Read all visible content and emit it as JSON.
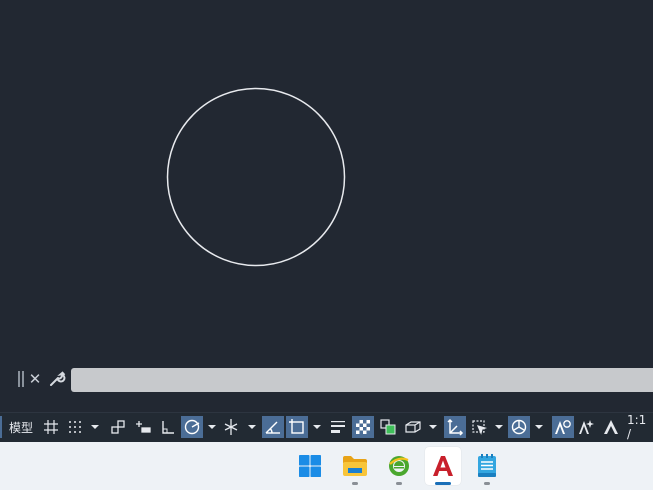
{
  "statusbar": {
    "model_label": "模型",
    "scale_label": "1:1 /"
  },
  "command_line": {
    "value": "",
    "placeholder": ""
  },
  "icons": {
    "grid": "grid-icon",
    "snap": "snap-mode-icon",
    "infer": "infer-constraints-icon",
    "dynamic_input": "dynamic-input-icon",
    "ortho": "ortho-mode-icon",
    "polar": "polar-tracking-icon",
    "isodraft": "isometric-drafting-icon",
    "object_snap_tracking": "object-snap-tracking-icon",
    "object_snap": "object-snap-icon",
    "lineweight": "lineweight-icon",
    "transparency": "transparency-icon",
    "selection_cycling": "selection-cycling-icon",
    "3d_osnap": "3d-object-snap-icon",
    "ucs": "dynamic-ucs-icon",
    "selection_filter": "selection-filtering-icon",
    "gizmo": "gizmo-icon",
    "annotation_visibility": "annotation-visibility-icon",
    "auto_scale": "auto-scale-icon",
    "annotation_scale": "annotation-scale-icon"
  },
  "taskbar": {
    "items": [
      "windows-start-icon",
      "file-explorer-icon",
      "browser-icon",
      "autocad-icon",
      "notepad-icon"
    ],
    "active": "autocad-icon"
  },
  "colors": {
    "canvas": "#222832",
    "active_toggle": "#4b6d96",
    "circle_stroke": "#e8eaee",
    "autocad_red": "#c8202b",
    "taskbar": "#eef2f6"
  }
}
